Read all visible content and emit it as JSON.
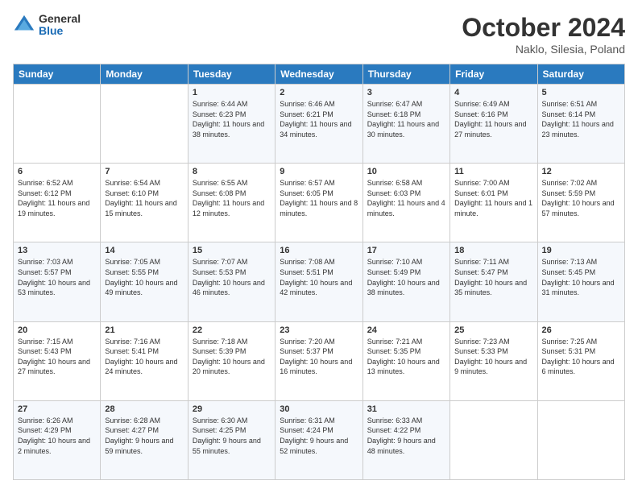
{
  "header": {
    "logo": {
      "general": "General",
      "blue": "Blue"
    },
    "title": "October 2024",
    "location": "Naklo, Silesia, Poland"
  },
  "days_of_week": [
    "Sunday",
    "Monday",
    "Tuesday",
    "Wednesday",
    "Thursday",
    "Friday",
    "Saturday"
  ],
  "weeks": [
    [
      {
        "day": "",
        "sunrise": "",
        "sunset": "",
        "daylight": ""
      },
      {
        "day": "",
        "sunrise": "",
        "sunset": "",
        "daylight": ""
      },
      {
        "day": "1",
        "sunrise": "Sunrise: 6:44 AM",
        "sunset": "Sunset: 6:23 PM",
        "daylight": "Daylight: 11 hours and 38 minutes."
      },
      {
        "day": "2",
        "sunrise": "Sunrise: 6:46 AM",
        "sunset": "Sunset: 6:21 PM",
        "daylight": "Daylight: 11 hours and 34 minutes."
      },
      {
        "day": "3",
        "sunrise": "Sunrise: 6:47 AM",
        "sunset": "Sunset: 6:18 PM",
        "daylight": "Daylight: 11 hours and 30 minutes."
      },
      {
        "day": "4",
        "sunrise": "Sunrise: 6:49 AM",
        "sunset": "Sunset: 6:16 PM",
        "daylight": "Daylight: 11 hours and 27 minutes."
      },
      {
        "day": "5",
        "sunrise": "Sunrise: 6:51 AM",
        "sunset": "Sunset: 6:14 PM",
        "daylight": "Daylight: 11 hours and 23 minutes."
      }
    ],
    [
      {
        "day": "6",
        "sunrise": "Sunrise: 6:52 AM",
        "sunset": "Sunset: 6:12 PM",
        "daylight": "Daylight: 11 hours and 19 minutes."
      },
      {
        "day": "7",
        "sunrise": "Sunrise: 6:54 AM",
        "sunset": "Sunset: 6:10 PM",
        "daylight": "Daylight: 11 hours and 15 minutes."
      },
      {
        "day": "8",
        "sunrise": "Sunrise: 6:55 AM",
        "sunset": "Sunset: 6:08 PM",
        "daylight": "Daylight: 11 hours and 12 minutes."
      },
      {
        "day": "9",
        "sunrise": "Sunrise: 6:57 AM",
        "sunset": "Sunset: 6:05 PM",
        "daylight": "Daylight: 11 hours and 8 minutes."
      },
      {
        "day": "10",
        "sunrise": "Sunrise: 6:58 AM",
        "sunset": "Sunset: 6:03 PM",
        "daylight": "Daylight: 11 hours and 4 minutes."
      },
      {
        "day": "11",
        "sunrise": "Sunrise: 7:00 AM",
        "sunset": "Sunset: 6:01 PM",
        "daylight": "Daylight: 11 hours and 1 minute."
      },
      {
        "day": "12",
        "sunrise": "Sunrise: 7:02 AM",
        "sunset": "Sunset: 5:59 PM",
        "daylight": "Daylight: 10 hours and 57 minutes."
      }
    ],
    [
      {
        "day": "13",
        "sunrise": "Sunrise: 7:03 AM",
        "sunset": "Sunset: 5:57 PM",
        "daylight": "Daylight: 10 hours and 53 minutes."
      },
      {
        "day": "14",
        "sunrise": "Sunrise: 7:05 AM",
        "sunset": "Sunset: 5:55 PM",
        "daylight": "Daylight: 10 hours and 49 minutes."
      },
      {
        "day": "15",
        "sunrise": "Sunrise: 7:07 AM",
        "sunset": "Sunset: 5:53 PM",
        "daylight": "Daylight: 10 hours and 46 minutes."
      },
      {
        "day": "16",
        "sunrise": "Sunrise: 7:08 AM",
        "sunset": "Sunset: 5:51 PM",
        "daylight": "Daylight: 10 hours and 42 minutes."
      },
      {
        "day": "17",
        "sunrise": "Sunrise: 7:10 AM",
        "sunset": "Sunset: 5:49 PM",
        "daylight": "Daylight: 10 hours and 38 minutes."
      },
      {
        "day": "18",
        "sunrise": "Sunrise: 7:11 AM",
        "sunset": "Sunset: 5:47 PM",
        "daylight": "Daylight: 10 hours and 35 minutes."
      },
      {
        "day": "19",
        "sunrise": "Sunrise: 7:13 AM",
        "sunset": "Sunset: 5:45 PM",
        "daylight": "Daylight: 10 hours and 31 minutes."
      }
    ],
    [
      {
        "day": "20",
        "sunrise": "Sunrise: 7:15 AM",
        "sunset": "Sunset: 5:43 PM",
        "daylight": "Daylight: 10 hours and 27 minutes."
      },
      {
        "day": "21",
        "sunrise": "Sunrise: 7:16 AM",
        "sunset": "Sunset: 5:41 PM",
        "daylight": "Daylight: 10 hours and 24 minutes."
      },
      {
        "day": "22",
        "sunrise": "Sunrise: 7:18 AM",
        "sunset": "Sunset: 5:39 PM",
        "daylight": "Daylight: 10 hours and 20 minutes."
      },
      {
        "day": "23",
        "sunrise": "Sunrise: 7:20 AM",
        "sunset": "Sunset: 5:37 PM",
        "daylight": "Daylight: 10 hours and 16 minutes."
      },
      {
        "day": "24",
        "sunrise": "Sunrise: 7:21 AM",
        "sunset": "Sunset: 5:35 PM",
        "daylight": "Daylight: 10 hours and 13 minutes."
      },
      {
        "day": "25",
        "sunrise": "Sunrise: 7:23 AM",
        "sunset": "Sunset: 5:33 PM",
        "daylight": "Daylight: 10 hours and 9 minutes."
      },
      {
        "day": "26",
        "sunrise": "Sunrise: 7:25 AM",
        "sunset": "Sunset: 5:31 PM",
        "daylight": "Daylight: 10 hours and 6 minutes."
      }
    ],
    [
      {
        "day": "27",
        "sunrise": "Sunrise: 6:26 AM",
        "sunset": "Sunset: 4:29 PM",
        "daylight": "Daylight: 10 hours and 2 minutes."
      },
      {
        "day": "28",
        "sunrise": "Sunrise: 6:28 AM",
        "sunset": "Sunset: 4:27 PM",
        "daylight": "Daylight: 9 hours and 59 minutes."
      },
      {
        "day": "29",
        "sunrise": "Sunrise: 6:30 AM",
        "sunset": "Sunset: 4:25 PM",
        "daylight": "Daylight: 9 hours and 55 minutes."
      },
      {
        "day": "30",
        "sunrise": "Sunrise: 6:31 AM",
        "sunset": "Sunset: 4:24 PM",
        "daylight": "Daylight: 9 hours and 52 minutes."
      },
      {
        "day": "31",
        "sunrise": "Sunrise: 6:33 AM",
        "sunset": "Sunset: 4:22 PM",
        "daylight": "Daylight: 9 hours and 48 minutes."
      },
      {
        "day": "",
        "sunrise": "",
        "sunset": "",
        "daylight": ""
      },
      {
        "day": "",
        "sunrise": "",
        "sunset": "",
        "daylight": ""
      }
    ]
  ]
}
